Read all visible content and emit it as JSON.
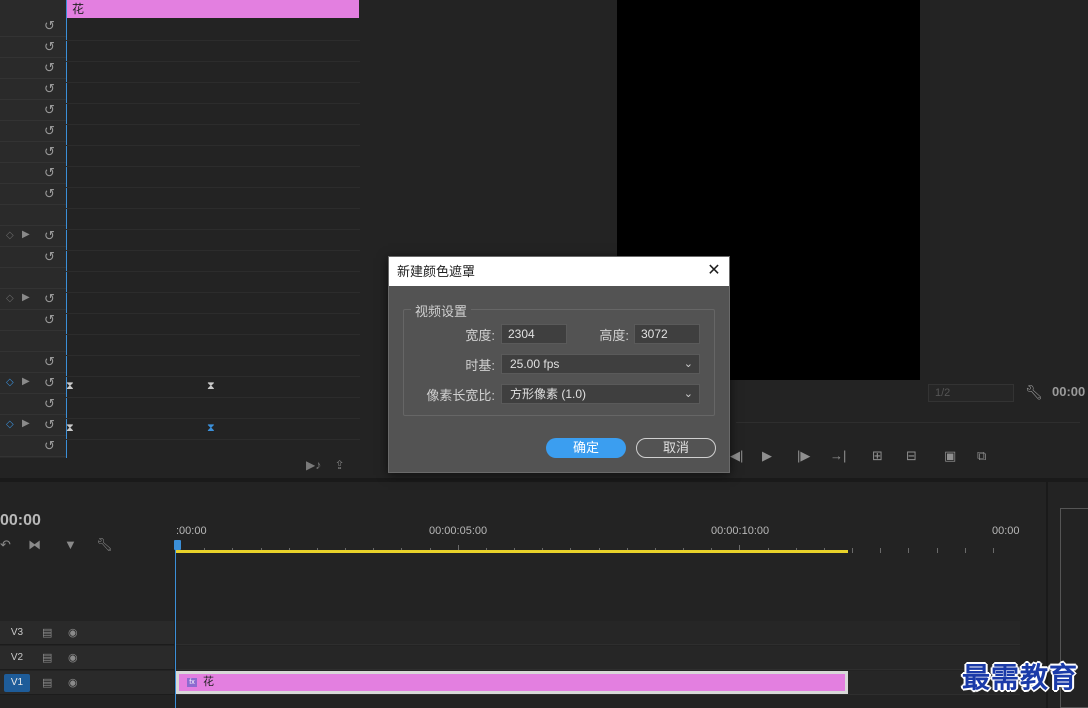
{
  "effect_controls": {
    "clip_label": "花",
    "reset_icon": "reset-icon",
    "keyframe_icon": "keyframe-icon"
  },
  "program_monitor": {
    "zoom": "1/2",
    "timecode": "00:00"
  },
  "timeline": {
    "timecode": "00:00",
    "ruler_labels": [
      ":00:00",
      "00:00:05:00",
      "00:00:10:00",
      "00:00"
    ],
    "tracks": [
      {
        "name": "V3",
        "active": false
      },
      {
        "name": "V2",
        "active": false
      },
      {
        "name": "V1",
        "active": true
      }
    ],
    "clip": {
      "label": "花",
      "fx": "fx"
    },
    "colors": {
      "clip": "#e37fe0",
      "work_area": "#e8d22a",
      "playhead": "#3b8fd8"
    }
  },
  "dialog": {
    "title": "新建颜色遮罩",
    "group_title": "视频设置",
    "width_label": "宽度:",
    "width_value": "2304",
    "height_label": "高度:",
    "height_value": "3072",
    "timebase_label": "时基:",
    "timebase_value": "25.00 fps",
    "par_label": "像素长宽比:",
    "par_value": "方形像素 (1.0)",
    "ok_label": "确定",
    "cancel_label": "取消"
  },
  "watermark": "最需教育"
}
